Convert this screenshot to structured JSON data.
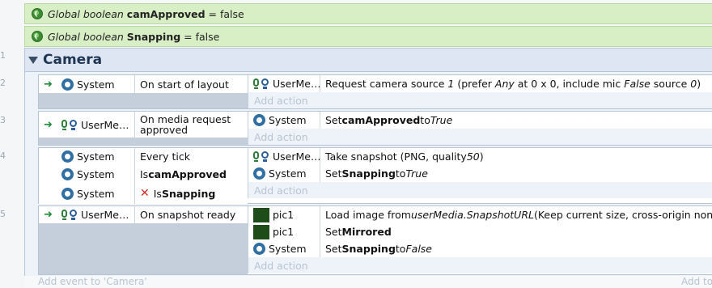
{
  "globals": [
    {
      "prefix": "Global boolean ",
      "name": "camApproved",
      "rest": " = false"
    },
    {
      "prefix": "Global boolean ",
      "name": "Snapping",
      "rest": " = false"
    }
  ],
  "line_numbers": [
    "1",
    "2",
    "3",
    "4",
    "5"
  ],
  "group": {
    "title": "Camera"
  },
  "add_action_label": "Add action",
  "events": [
    {
      "conditions": [
        {
          "object": "System",
          "text": "On start of layout"
        }
      ],
      "actions": [
        {
          "object": "UserMe…",
          "text": "Request camera source 1 (prefer Any at 0 x 0, include mic False source 0)"
        }
      ]
    },
    {
      "conditions": [
        {
          "object": "UserMe…",
          "text": "On media request approved"
        }
      ],
      "actions": [
        {
          "object": "System",
          "text_pre": "Set ",
          "bold": "camApproved",
          "text_mid": " to ",
          "italic": "True"
        }
      ]
    },
    {
      "conditions": [
        {
          "object": "System",
          "text": "Every tick"
        },
        {
          "object": "System",
          "text_pre": "Is ",
          "bold": "camApproved"
        },
        {
          "object": "System",
          "text_pre": "Is ",
          "bold": "Snapping",
          "inverted": true
        }
      ],
      "actions": [
        {
          "object": "UserMe…",
          "text_pre": "Take snapshot (PNG, quality ",
          "italic": "50",
          "text_post": ")"
        },
        {
          "object": "System",
          "text_pre": "Set ",
          "bold": "Snapping",
          "text_mid": " to ",
          "italic": "True"
        }
      ]
    },
    {
      "conditions": [
        {
          "object": "UserMe…",
          "text": "On snapshot ready"
        }
      ],
      "actions": [
        {
          "object": "pic1",
          "text_pre": "Load image from ",
          "italic": "userMedia.SnapshotURL",
          "text_post": " (Keep current size, cross-origin none)"
        },
        {
          "object": "pic1",
          "text_pre": "Set ",
          "bold": "Mirrored"
        },
        {
          "object": "System",
          "text_pre": "Set ",
          "bold": "Snapping",
          "text_mid": " to ",
          "italic": "False"
        }
      ]
    }
  ],
  "footer": {
    "add_event": "Add event to 'Camera'",
    "add_to": "Add to"
  }
}
